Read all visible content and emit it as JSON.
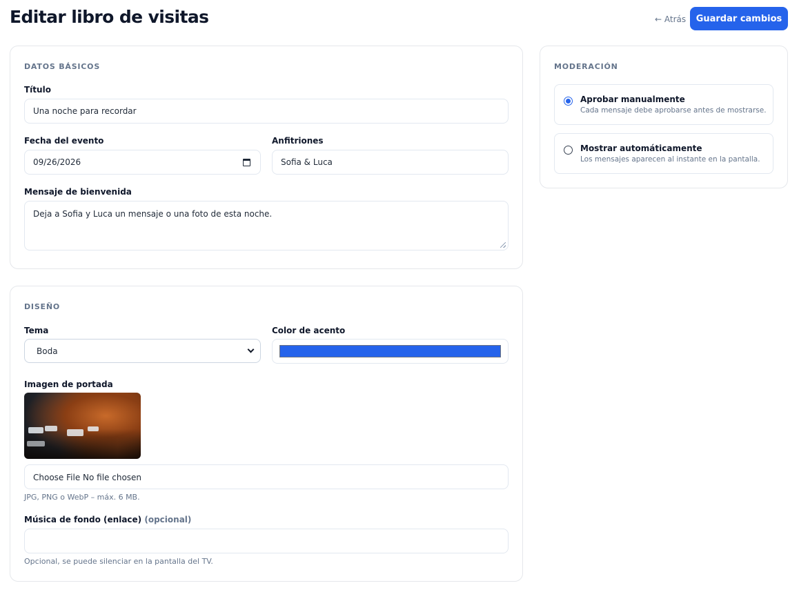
{
  "header": {
    "title": "Editar libro de visitas",
    "back_label": "← Atrás",
    "save_label": "Guardar cambios"
  },
  "basics": {
    "section_title": "DATOS BÁSICOS",
    "title_label": "Título",
    "title_value": "Una noche para recordar",
    "date_label": "Fecha del evento",
    "date_value": "09/26/2026",
    "hosts_label": "Anfitriones",
    "hosts_value": "Sofia & Luca",
    "welcome_label": "Mensaje de bienvenida",
    "welcome_value": "Deja a Sofia y Luca un mensaje o una foto de esta noche."
  },
  "design": {
    "section_title": "DISEÑO",
    "theme_label": "Tema",
    "theme_value": "Boda",
    "accent_label": "Color de acento",
    "accent_color": "#2563eb",
    "cover_label": "Imagen de portada",
    "file_button": "Choose File",
    "file_status": "No file chosen",
    "file_hint": "JPG, PNG o WebP – máx. 6 MB.",
    "music_label": "Música de fondo (enlace)",
    "music_optional": "(opcional)",
    "music_value": "",
    "music_hint": "Opcional, se puede silenciar en la pantalla del TV."
  },
  "moderation": {
    "section_title": "MODERACIÓN",
    "options": [
      {
        "title": "Aprobar manualmente",
        "description": "Cada mensaje debe aprobarse antes de mostrarse.",
        "selected": true
      },
      {
        "title": "Mostrar automáticamente",
        "description": "Los mensajes aparecen al instante en la pantalla.",
        "selected": false
      }
    ]
  },
  "colors": {
    "primary": "#2563eb",
    "muted_text": "#64748b",
    "border": "#e5e7eb"
  }
}
